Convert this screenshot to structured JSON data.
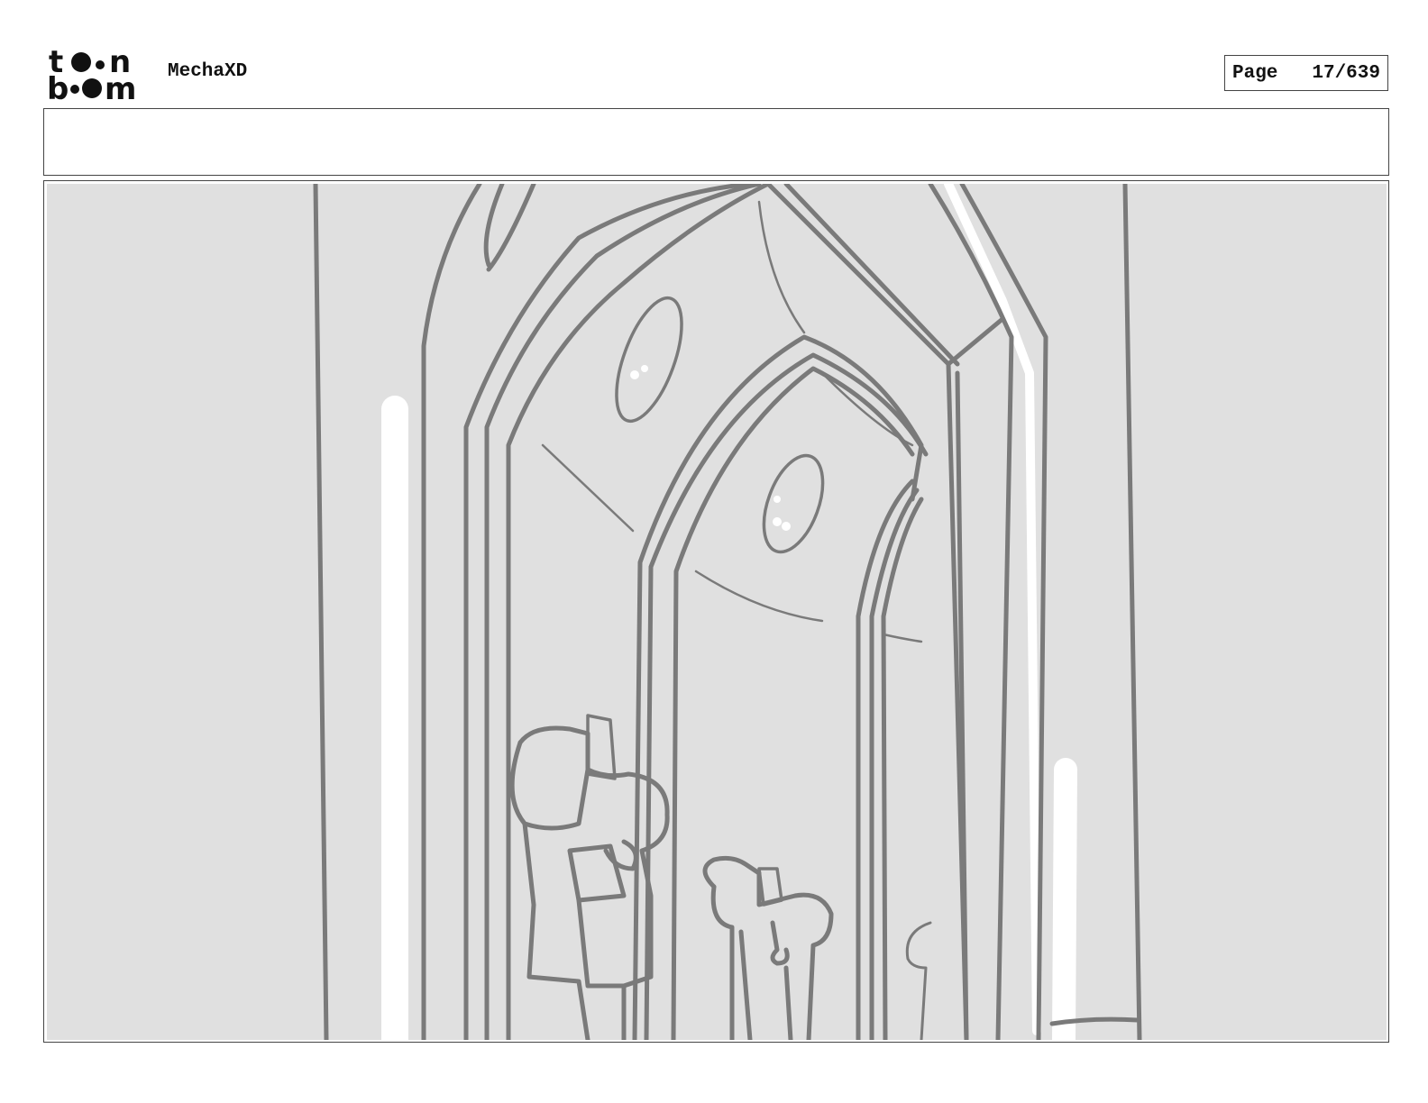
{
  "header": {
    "logo_icon": "toonboom-logo-icon",
    "project_title": "MechaXD",
    "page_label": "Page",
    "page_number": "17/639"
  },
  "caption": {
    "text": ""
  },
  "panel": {
    "background_color": "#e0e0e0",
    "line_color": "#7a7a7a"
  }
}
